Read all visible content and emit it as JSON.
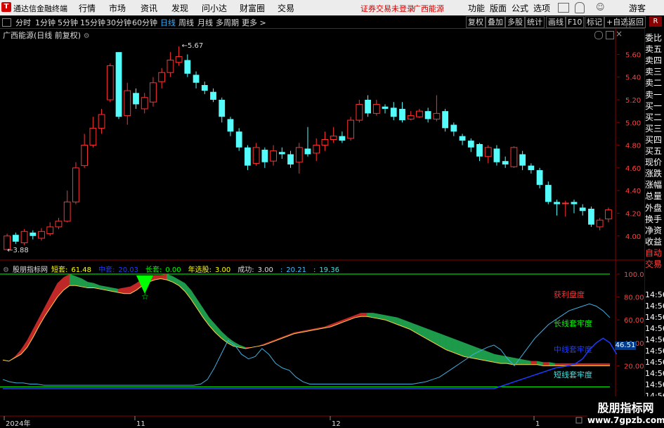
{
  "app": {
    "title": "通达信金融终端"
  },
  "menu": [
    "行情",
    "市场",
    "资讯",
    "发现",
    "问小达",
    "财富圈",
    "交易"
  ],
  "login_warning": "证券交易未登录",
  "stock_name_top": "广西能源",
  "right_menu": [
    "功能",
    "版面",
    "公式",
    "选项"
  ],
  "guest": "游客",
  "periods": [
    "分时",
    "1分钟",
    "5分钟",
    "15分钟",
    "30分钟",
    "60分钟",
    "日线",
    "周线",
    "月线",
    "多周期",
    "更多 >"
  ],
  "toolbar": [
    "复权",
    "叠加",
    "多股",
    "统计",
    "画线",
    "F10",
    "标记",
    "+自选",
    "返回"
  ],
  "r_badge": "R",
  "chart_header": "广西能源(日线 前复权)",
  "price_axis": [
    "5.60",
    "5.40",
    "5.20",
    "5.00",
    "4.80",
    "4.60",
    "4.40",
    "4.20",
    "4.00"
  ],
  "price_max_label": "5.67",
  "price_min_label": "3.88",
  "indicator": {
    "name": "股朋指标网",
    "items": [
      {
        "label": "短套:",
        "value": "61.48",
        "color": "#ffff00"
      },
      {
        "label": "中套:",
        "value": "20.03",
        "color": "#1c3cff"
      },
      {
        "label": "长套:",
        "value": "0.00",
        "color": "#00ff00"
      },
      {
        "label": "年选股:",
        "value": "3.00",
        "color": "#ffff00"
      },
      {
        "label": "成功:",
        "value": "3.00",
        "color": "#dddddd"
      },
      {
        "label": ":",
        "value": "20.21",
        "color": "#40c0ff"
      },
      {
        "label": ":",
        "value": "19.36",
        "color": "#40e0e0"
      }
    ],
    "axis": [
      "100.0",
      "80.00",
      "60.00",
      "40.00",
      "20.00"
    ],
    "current_value": "46.51",
    "annotations": {
      "profit": "获利盘度",
      "long": "长线套牢度",
      "mid": "中线套牢度",
      "short": "短线套牢度"
    }
  },
  "side_panel": [
    "委比",
    "卖五",
    "卖四",
    "卖三",
    "卖二",
    "卖一",
    "买一",
    "买二",
    "买三",
    "买四",
    "买五",
    "现价",
    "涨跌",
    "涨幅",
    "总量",
    "外盘",
    "换手",
    "净资",
    "收益",
    "自动",
    "交易"
  ],
  "side_times": [
    "14:56",
    "14:56",
    "14:56",
    "14:56",
    "14:56",
    "14:56",
    "14:56",
    "14:56",
    "14:56",
    "14:56",
    "14:56"
  ],
  "date_axis": [
    "2024年",
    "11",
    "12",
    "1"
  ],
  "watermark": {
    "line1": "股朋指标网",
    "line2": "www.7gpzb.com"
  },
  "chart_data": {
    "type": "candlestick",
    "title": "广西能源(日线 前复权)",
    "ylim": [
      3.85,
      5.72
    ],
    "annotations": {
      "max": 5.67,
      "min": 3.88
    },
    "candles": [
      {
        "o": 3.88,
        "c": 4.0,
        "h": 4.02,
        "l": 3.88
      },
      {
        "o": 4.01,
        "c": 3.95,
        "h": 4.03,
        "l": 3.93
      },
      {
        "o": 3.94,
        "c": 4.04,
        "h": 4.06,
        "l": 3.92
      },
      {
        "o": 4.03,
        "c": 4.0,
        "h": 4.05,
        "l": 3.97
      },
      {
        "o": 3.98,
        "c": 4.04,
        "h": 4.07,
        "l": 3.96
      },
      {
        "o": 4.02,
        "c": 4.08,
        "h": 4.12,
        "l": 4.0
      },
      {
        "o": 4.08,
        "c": 4.13,
        "h": 4.16,
        "l": 4.06
      },
      {
        "o": 4.13,
        "c": 4.3,
        "h": 4.4,
        "l": 4.12
      },
      {
        "o": 4.3,
        "c": 4.6,
        "h": 4.65,
        "l": 4.28
      },
      {
        "o": 4.62,
        "c": 4.8,
        "h": 4.9,
        "l": 4.6
      },
      {
        "o": 4.8,
        "c": 4.95,
        "h": 5.05,
        "l": 4.78
      },
      {
        "o": 4.95,
        "c": 5.07,
        "h": 5.12,
        "l": 4.9
      },
      {
        "o": 5.2,
        "c": 5.5,
        "h": 5.52,
        "l": 5.18
      },
      {
        "o": 5.62,
        "c": 5.05,
        "h": 5.62,
        "l": 5.03
      },
      {
        "o": 5.06,
        "c": 5.28,
        "h": 5.35,
        "l": 4.98
      },
      {
        "o": 5.26,
        "c": 5.16,
        "h": 5.3,
        "l": 5.12
      },
      {
        "o": 5.12,
        "c": 5.22,
        "h": 5.26,
        "l": 5.08
      },
      {
        "o": 5.18,
        "c": 5.35,
        "h": 5.4,
        "l": 5.14
      },
      {
        "o": 5.36,
        "c": 5.44,
        "h": 5.48,
        "l": 5.3
      },
      {
        "o": 5.44,
        "c": 5.55,
        "h": 5.62,
        "l": 5.4
      },
      {
        "o": 5.53,
        "c": 5.58,
        "h": 5.67,
        "l": 5.5
      },
      {
        "o": 5.55,
        "c": 5.43,
        "h": 5.6,
        "l": 5.4
      },
      {
        "o": 5.42,
        "c": 5.35,
        "h": 5.45,
        "l": 5.3
      },
      {
        "o": 5.33,
        "c": 5.28,
        "h": 5.36,
        "l": 5.25
      },
      {
        "o": 5.27,
        "c": 5.2,
        "h": 5.3,
        "l": 5.18
      },
      {
        "o": 5.2,
        "c": 5.05,
        "h": 5.22,
        "l": 5.0
      },
      {
        "o": 5.03,
        "c": 4.92,
        "h": 5.05,
        "l": 4.88
      },
      {
        "o": 4.92,
        "c": 4.78,
        "h": 4.95,
        "l": 4.75
      },
      {
        "o": 4.78,
        "c": 4.62,
        "h": 4.8,
        "l": 4.58
      },
      {
        "o": 4.64,
        "c": 4.78,
        "h": 4.82,
        "l": 4.62
      },
      {
        "o": 4.76,
        "c": 4.65,
        "h": 4.78,
        "l": 4.6
      },
      {
        "o": 4.66,
        "c": 4.75,
        "h": 4.8,
        "l": 4.62
      },
      {
        "o": 4.74,
        "c": 4.72,
        "h": 4.78,
        "l": 4.68
      },
      {
        "o": 4.72,
        "c": 4.63,
        "h": 4.75,
        "l": 4.6
      },
      {
        "o": 4.65,
        "c": 4.78,
        "h": 4.82,
        "l": 4.55
      },
      {
        "o": 4.77,
        "c": 4.72,
        "h": 4.96,
        "l": 4.7
      },
      {
        "o": 4.73,
        "c": 4.8,
        "h": 4.86,
        "l": 4.66
      },
      {
        "o": 4.8,
        "c": 4.85,
        "h": 4.92,
        "l": 4.75
      },
      {
        "o": 4.85,
        "c": 4.88,
        "h": 4.96,
        "l": 4.82
      },
      {
        "o": 4.88,
        "c": 4.84,
        "h": 4.92,
        "l": 4.82
      },
      {
        "o": 4.86,
        "c": 5.02,
        "h": 5.05,
        "l": 4.84
      },
      {
        "o": 5.02,
        "c": 5.16,
        "h": 5.2,
        "l": 5.0
      },
      {
        "o": 5.2,
        "c": 5.08,
        "h": 5.24,
        "l": 5.05
      },
      {
        "o": 5.08,
        "c": 5.16,
        "h": 5.2,
        "l": 5.06
      },
      {
        "o": 5.14,
        "c": 5.12,
        "h": 5.16,
        "l": 5.08
      },
      {
        "o": 5.13,
        "c": 5.05,
        "h": 5.18,
        "l": 5.02
      },
      {
        "o": 5.12,
        "c": 5.02,
        "h": 5.18,
        "l": 5.0
      },
      {
        "o": 5.03,
        "c": 5.06,
        "h": 5.1,
        "l": 5.02
      },
      {
        "o": 5.05,
        "c": 5.1,
        "h": 5.12,
        "l": 5.04
      },
      {
        "o": 5.1,
        "c": 5.03,
        "h": 5.13,
        "l": 5.0
      },
      {
        "o": 5.03,
        "c": 5.08,
        "h": 5.24,
        "l": 5.01
      },
      {
        "o": 5.1,
        "c": 4.95,
        "h": 5.12,
        "l": 4.92
      },
      {
        "o": 4.98,
        "c": 4.92,
        "h": 5.0,
        "l": 4.88
      },
      {
        "o": 4.88,
        "c": 4.84,
        "h": 4.9,
        "l": 4.8
      },
      {
        "o": 4.84,
        "c": 4.78,
        "h": 4.86,
        "l": 4.74
      },
      {
        "o": 4.81,
        "c": 4.7,
        "h": 4.82,
        "l": 4.66
      },
      {
        "o": 4.7,
        "c": 4.78,
        "h": 4.8,
        "l": 4.64
      },
      {
        "o": 4.77,
        "c": 4.65,
        "h": 4.8,
        "l": 4.62
      },
      {
        "o": 4.66,
        "c": 4.63,
        "h": 4.7,
        "l": 4.6
      },
      {
        "o": 4.61,
        "c": 4.78,
        "h": 4.79,
        "l": 4.6
      },
      {
        "o": 4.72,
        "c": 4.62,
        "h": 4.75,
        "l": 4.58
      },
      {
        "o": 4.62,
        "c": 4.58,
        "h": 4.64,
        "l": 4.55
      },
      {
        "o": 4.58,
        "c": 4.45,
        "h": 4.6,
        "l": 4.42
      },
      {
        "o": 4.45,
        "c": 4.3,
        "h": 4.48,
        "l": 4.28
      },
      {
        "o": 4.3,
        "c": 4.28,
        "h": 4.32,
        "l": 4.18
      },
      {
        "o": 4.29,
        "c": 4.29,
        "h": 4.31,
        "l": 4.17
      },
      {
        "o": 4.3,
        "c": 4.28,
        "h": 4.32,
        "l": 4.2
      },
      {
        "o": 4.25,
        "c": 4.22,
        "h": 4.28,
        "l": 4.18
      },
      {
        "o": 4.24,
        "c": 4.1,
        "h": 4.26,
        "l": 4.08
      },
      {
        "o": 4.08,
        "c": 4.14,
        "h": 4.16,
        "l": 4.05
      },
      {
        "o": 4.15,
        "c": 4.23,
        "h": 4.25,
        "l": 4.12
      }
    ],
    "indicator_series": {
      "ylim": [
        0,
        100
      ],
      "profit_upper": [
        25,
        24,
        28,
        34,
        42,
        52,
        62,
        72,
        82,
        92,
        97,
        100,
        98,
        96,
        93,
        92,
        90,
        89,
        88,
        87,
        88,
        89,
        92,
        96,
        98,
        99,
        99,
        100,
        98,
        95,
        92,
        86,
        78,
        70,
        62,
        56,
        50,
        45,
        41,
        38,
        36,
        36,
        37,
        39,
        41,
        43,
        45,
        47,
        49,
        50,
        51,
        52,
        53,
        54,
        56,
        58,
        60,
        62,
        64,
        66,
        66,
        66,
        65,
        64,
        63,
        62,
        60,
        58,
        56,
        54,
        52,
        50,
        48,
        46,
        44,
        42,
        40,
        38,
        36,
        34,
        32,
        30,
        29,
        28,
        27,
        26,
        25,
        24,
        24,
        23,
        23,
        22,
        22,
        22,
        22,
        22,
        22,
        22,
        22,
        22,
        22
      ],
      "profit_lower": [
        25,
        24,
        27,
        30,
        36,
        45,
        55,
        64,
        72,
        80,
        86,
        90,
        90,
        89,
        88,
        88,
        87,
        86,
        85,
        84,
        83,
        83,
        86,
        90,
        93,
        95,
        96,
        95,
        93,
        90,
        85,
        78,
        70,
        62,
        55,
        49,
        44,
        40,
        37,
        36,
        35,
        36,
        37,
        38,
        40,
        42,
        44,
        46,
        48,
        49,
        50,
        51,
        52,
        53,
        54,
        56,
        58,
        60,
        62,
        63,
        63,
        62,
        61,
        60,
        58,
        56,
        54,
        52,
        49,
        46,
        43,
        40,
        37,
        34,
        32,
        30,
        28,
        27,
        26,
        25,
        24,
        23,
        22,
        22,
        21,
        21,
        21,
        21,
        21,
        20,
        20,
        20,
        20,
        20,
        20,
        20,
        20,
        20,
        20,
        20,
        20
      ],
      "short": [
        8,
        6,
        5,
        5,
        4,
        4,
        3,
        3,
        3,
        3,
        3,
        3,
        3,
        3,
        3,
        3,
        3,
        3,
        3,
        3,
        3,
        3,
        3,
        3,
        3,
        3,
        3,
        3,
        3,
        4,
        8,
        18,
        30,
        42,
        38,
        30,
        26,
        28,
        35,
        30,
        22,
        18,
        16,
        10,
        6,
        4,
        4,
        4,
        4,
        4,
        4,
        4,
        4,
        4,
        4,
        4,
        4,
        4,
        4,
        4,
        4,
        5,
        6,
        8,
        10,
        14,
        18,
        22,
        26,
        30,
        33,
        36,
        38,
        34,
        26,
        20,
        28,
        36,
        44,
        50,
        56,
        60,
        64,
        68,
        70,
        72,
        74,
        72,
        68,
        62
      ],
      "mid": [
        0,
        0,
        0,
        0,
        0,
        0,
        0,
        0,
        0,
        0,
        0,
        0,
        0,
        0,
        0,
        0,
        0,
        0,
        0,
        0,
        0,
        0,
        0,
        0,
        0,
        0,
        0,
        0,
        0,
        0,
        0,
        0,
        0,
        0,
        0,
        0,
        0,
        0,
        0,
        0,
        0,
        0,
        0,
        0,
        0,
        0,
        0,
        0,
        0,
        0,
        0,
        0,
        0,
        0,
        0,
        0,
        0,
        0,
        0,
        0,
        0,
        0,
        0,
        0,
        0,
        0,
        0,
        0,
        0,
        0,
        0,
        0,
        0,
        2,
        4,
        6,
        8,
        10,
        12,
        14,
        16,
        18,
        19,
        20,
        22,
        26,
        34,
        40,
        44,
        40,
        30
      ]
    }
  }
}
